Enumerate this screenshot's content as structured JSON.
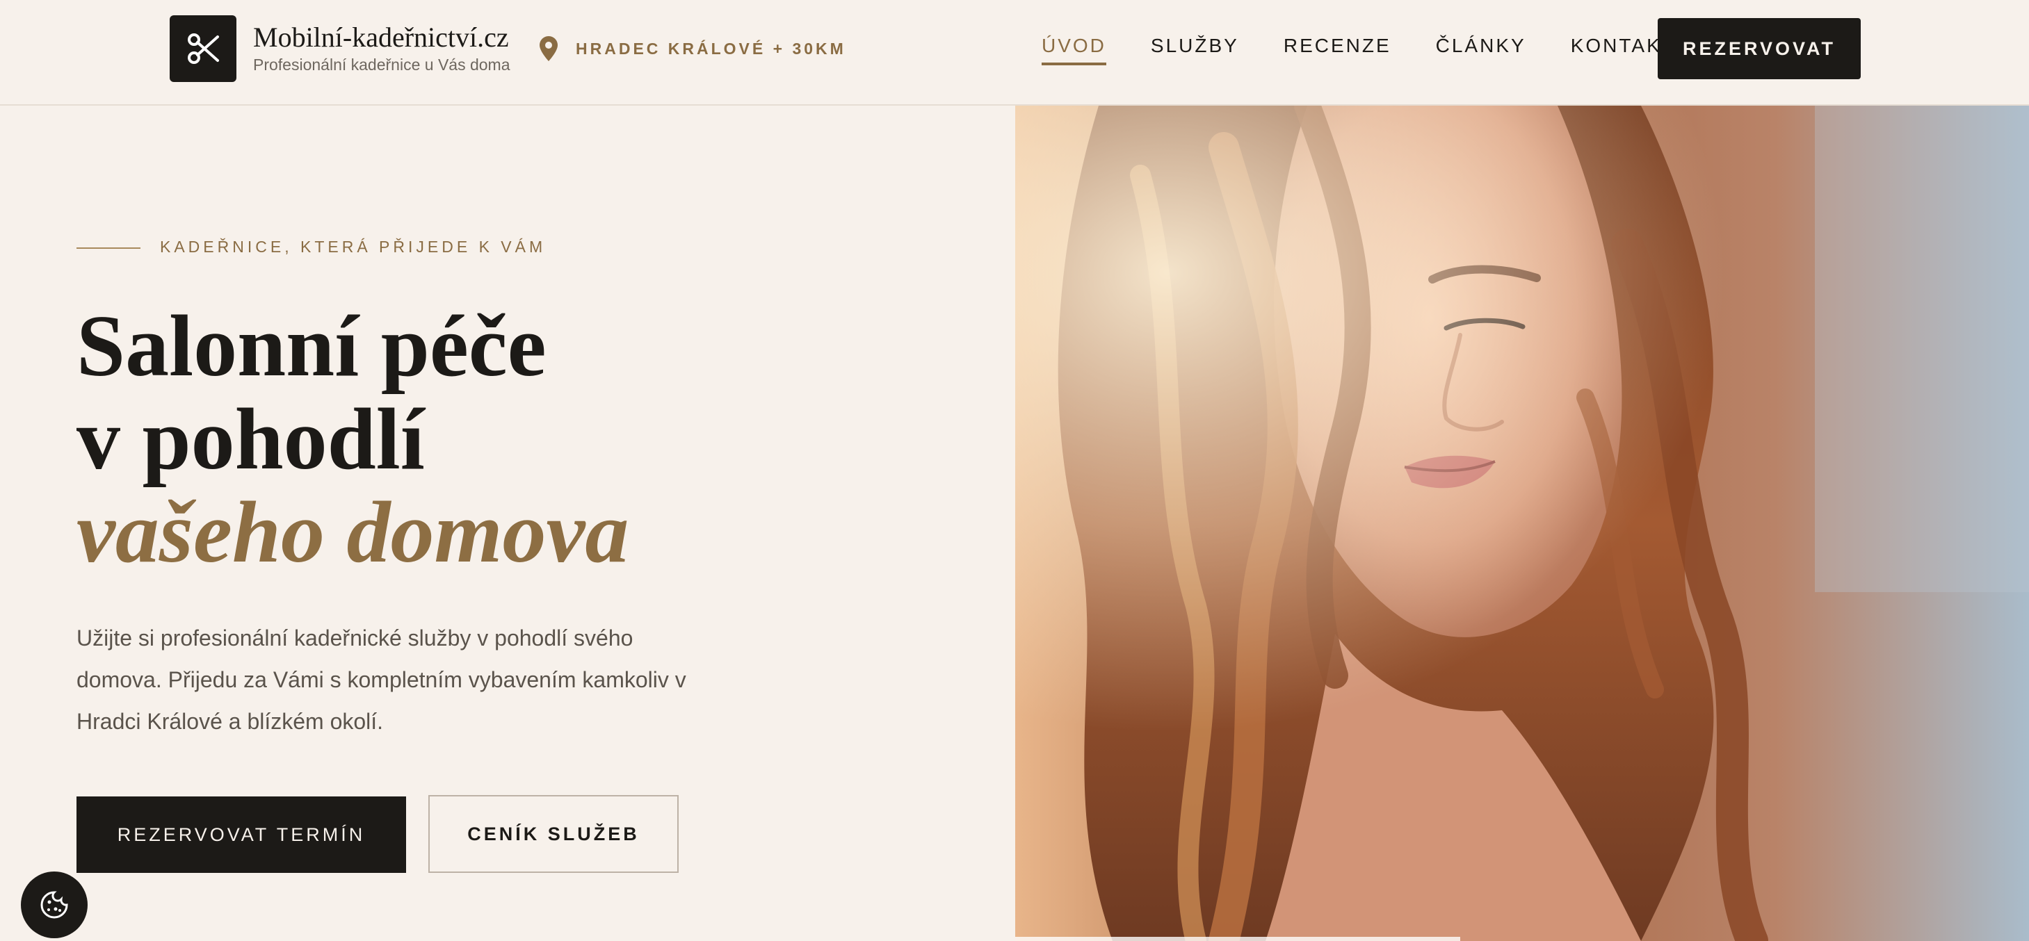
{
  "header": {
    "brand_name": "Mobilní-kadeřnictví.cz",
    "brand_tagline": "Profesionální kadeřnice u Vás doma",
    "location": "HRADEC KRÁLOVÉ + 30KM",
    "nav": [
      {
        "label": "ÚVOD",
        "active": true
      },
      {
        "label": "SLUŽBY",
        "active": false
      },
      {
        "label": "RECENZE",
        "active": false
      },
      {
        "label": "ČLÁNKY",
        "active": false
      },
      {
        "label": "KONTAKT",
        "active": false
      }
    ],
    "cta_label": "REZERVOVAT"
  },
  "hero": {
    "eyebrow": "KADEŘNICE, KTERÁ PŘIJEDE K VÁM",
    "headline_line1": "Salonní péče",
    "headline_line2": "v pohodlí",
    "headline_accent": "vašeho domova",
    "intro": "Užijte si profesionální kadeřnické služby v pohodlí svého domova. Přijedu za Vámi s kompletním vybavením kamkoliv v Hradci Králové a blízkém okolí.",
    "primary_button": "REZERVOVAT TERMÍN",
    "secondary_button": "CENÍK SLUŽEB"
  },
  "icons": {
    "logo": "scissors-icon",
    "location": "map-pin-icon",
    "cookie": "cookie-icon"
  },
  "colors": {
    "background": "#f7f1eb",
    "dark": "#1c1a17",
    "accent": "#8a6c43"
  }
}
